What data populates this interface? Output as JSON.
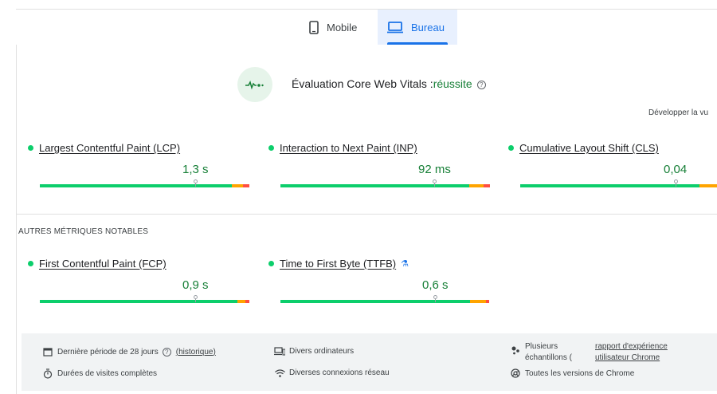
{
  "tabs": [
    {
      "label": "Mobile",
      "icon": "smartphone-icon",
      "selected": false
    },
    {
      "label": "Bureau",
      "icon": "laptop-icon",
      "selected": true
    }
  ],
  "assessment": {
    "title": "Évaluation Core Web Vitals :",
    "status": "réussite",
    "expand_label": "Développer la vu"
  },
  "core_metrics": [
    {
      "name": "Largest Contentful Paint (LCP)",
      "value": "1,3 s",
      "status_color": "#0cce6b"
    },
    {
      "name": "Interaction to Next Paint (INP)",
      "value": "92 ms",
      "status_color": "#0cce6b"
    },
    {
      "name": "Cumulative Layout Shift (CLS)",
      "value": "0,04",
      "status_color": "#0cce6b"
    }
  ],
  "other_section_title": "AUTRES MÉTRIQUES NOTABLES",
  "other_metrics": [
    {
      "name": "First Contentful Paint (FCP)",
      "value": "0,9 s"
    },
    {
      "name": "Time to First Byte (TTFB)",
      "value": "0,6 s",
      "icon": "flask-icon"
    }
  ],
  "footer": {
    "period": "Dernière période de 28 jours",
    "history_link": "(historique)",
    "visits": "Durées de visites complètes",
    "devices": "Divers ordinateurs",
    "network": "Diverses connexions réseau",
    "samples": "Plusieurs échantillons (",
    "report_link": "rapport d'expérience utilisateur Chrome",
    "chrome_versions": "Toutes les versions de Chrome"
  },
  "colors": {
    "good": "#0cce6b",
    "needs_improvement": "#ffa400",
    "poor": "#ff4e42",
    "accent": "#1a73e8"
  }
}
